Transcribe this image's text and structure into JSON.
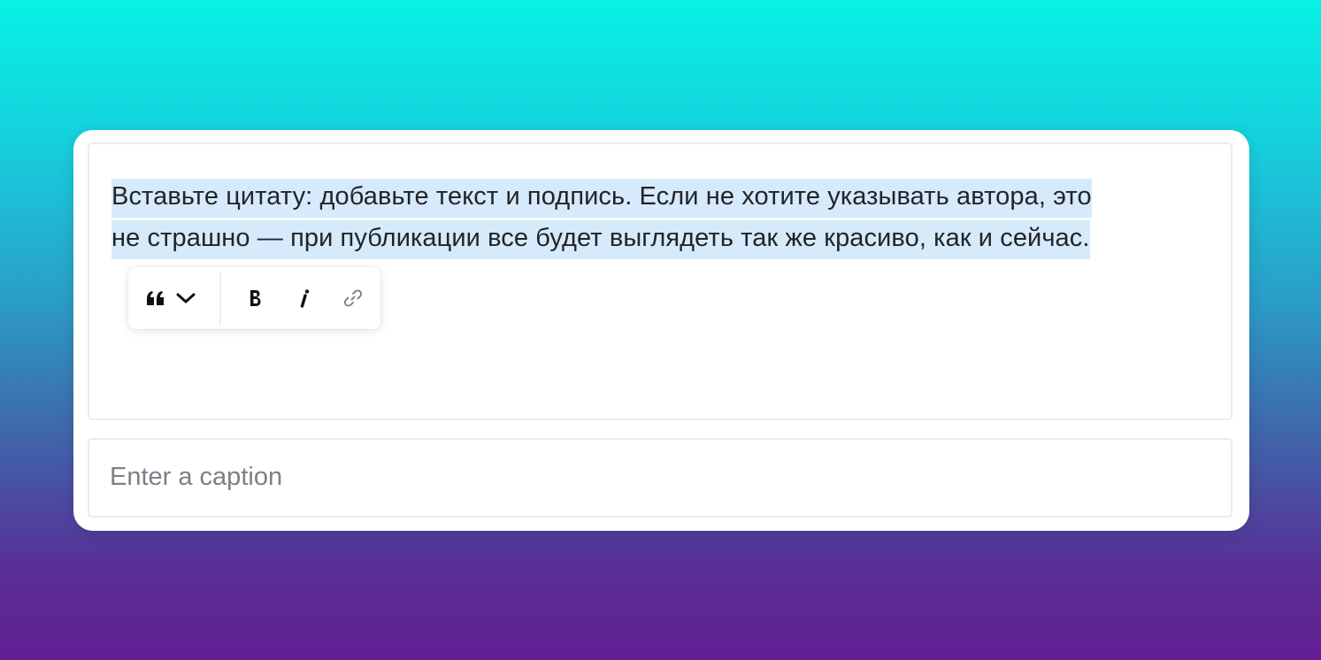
{
  "quote_block": {
    "line1": "Вставьте цитату: добавьте текст и подпись. Если не хотите указывать автора, это",
    "line2": "не страшно — при публикации все будет выглядеть так же красиво, как и сейчас."
  },
  "toolbar": {
    "quote_icon": "quote-icon",
    "dropdown_icon": "chevron-down-icon",
    "bold_icon": "bold-icon",
    "italic_icon": "italic-icon",
    "link_icon": "link-icon"
  },
  "caption": {
    "value": "",
    "placeholder": "Enter a caption"
  },
  "colors": {
    "selection": "#d6eafc",
    "text": "#222428",
    "placeholder": "#7c8088",
    "border": "#ececee"
  }
}
